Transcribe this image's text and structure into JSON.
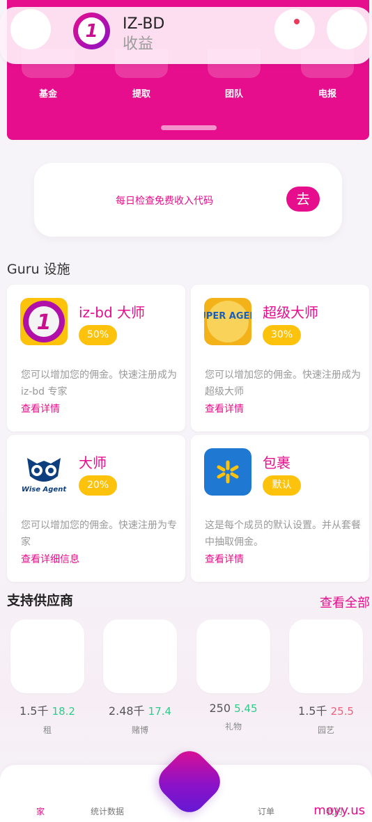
{
  "header": {
    "brand_name": "IZ-BD",
    "brand_sub": "收益"
  },
  "quick_actions": [
    {
      "label": "基金"
    },
    {
      "label": "提取"
    },
    {
      "label": "团队"
    },
    {
      "label": "电报"
    }
  ],
  "daily_code": {
    "text": "每日检查免费收入代码",
    "button": "去"
  },
  "guru": {
    "title": "Guru 设施",
    "cards": [
      {
        "name": "iz-bd 大师",
        "badge": "50%",
        "desc": "您可以增加您的佣金。快速注册成为 iz-bd 专家",
        "link": "查看详情"
      },
      {
        "name": "超级大师",
        "badge": "30%",
        "desc": "您可以增加您的佣金。快速注册成为超级大师",
        "link": "查看详情",
        "logo_text": "SUPER AGENT"
      },
      {
        "name": "大师",
        "badge": "20%",
        "desc": "您可以增加您的佣金。快速注册为专家",
        "link": "查看详细信息",
        "logo_text": "Wise Agent"
      },
      {
        "name": "包裹",
        "badge": "默认",
        "desc": "这是每个成员的默认设置。并从套餐中抽取佣金。",
        "link": "查看详情"
      }
    ]
  },
  "vendors": {
    "title": "支持供应商",
    "view_all": "查看全部",
    "items": [
      {
        "count": "1.5千",
        "value": "18.2",
        "trend": "pos",
        "name": "租"
      },
      {
        "count": "2.48千",
        "value": "17.4",
        "trend": "pos",
        "name": "赌博"
      },
      {
        "count": "250",
        "value": "5.45",
        "trend": "pos",
        "name": "礼物"
      },
      {
        "count": "1.5千",
        "value": "25.5",
        "trend": "neg",
        "name": "园艺"
      }
    ]
  },
  "nav": {
    "home": "家",
    "stats": "统计数据",
    "orders": "订单",
    "profile": "我的"
  },
  "watermark": "moyy.us",
  "colors": {
    "accent": "#e60e8c",
    "badge": "#fdc20c",
    "positive": "#2ecc8a",
    "negative": "#f0607c"
  }
}
